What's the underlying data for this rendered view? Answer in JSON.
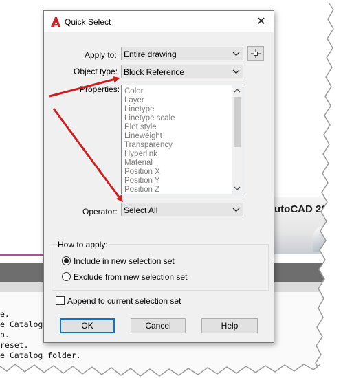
{
  "background": {
    "banner_text": "utoCAD 20",
    "console_lines": [
      "e.",
      "e Catalog",
      "n.",
      " reset.",
      "e Catalog folder."
    ]
  },
  "dialog": {
    "title": "Quick Select",
    "close_symbol": "✕",
    "apply_to": {
      "label": "Apply to:",
      "value": "Entire drawing"
    },
    "object_type": {
      "label": "Object type:",
      "value": "Block Reference"
    },
    "properties": {
      "label": "Properties:",
      "items": [
        "Color",
        "Layer",
        "Linetype",
        "Linetype scale",
        "Plot style",
        "Lineweight",
        "Transparency",
        "Hyperlink",
        "Material",
        "Position X",
        "Position Y",
        "Position Z"
      ]
    },
    "operator": {
      "label": "Operator:",
      "value": "Select All"
    },
    "how_to_apply": {
      "legend": "How to apply:",
      "include_label": "Include in new selection set",
      "exclude_label": "Exclude from new selection set",
      "selected": "include"
    },
    "append_label": "Append to current selection set",
    "append_checked": false,
    "buttons": {
      "ok": "OK",
      "cancel": "Cancel",
      "help": "Help"
    }
  },
  "icons": {
    "app": "autocad-logo-icon",
    "pick": "crosshair-pick-icon",
    "chevron": "chevron-down-icon"
  },
  "colors": {
    "annotation_arrow": "#cc1f1f",
    "autocad_red": "#d62027",
    "default_button_border": "#0078d7"
  }
}
